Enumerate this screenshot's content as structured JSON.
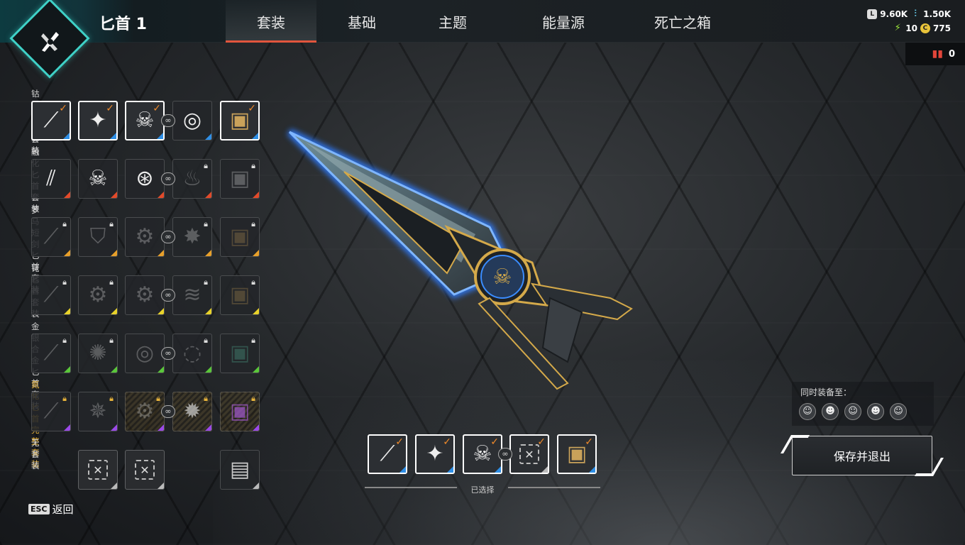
{
  "header": {
    "title": "匕首 1",
    "tabs": [
      {
        "label": "套装",
        "active": true
      },
      {
        "label": "基础",
        "active": false
      },
      {
        "label": "主题",
        "active": false
      },
      {
        "label": "能量源",
        "active": false
      },
      {
        "label": "死亡之箱",
        "active": false
      }
    ],
    "currency": {
      "legend_tokens": "9.60K",
      "crystals": "1.50K",
      "exotic": "10",
      "crafting": "775",
      "tickets": "0"
    }
  },
  "sets": [
    {
      "label": "钴蓝匕首套装",
      "gold": false
    },
    {
      "label": "融化匕首套装",
      "gold": false
    },
    {
      "label": "罗马短剑匕首套装",
      "gold": false
    },
    {
      "label": "铑匕首套装",
      "gold": false
    },
    {
      "label": "金银合金匕首套装",
      "gold": false
    },
    {
      "label": "氮化匕首完整套装",
      "gold": true
    },
    {
      "label": "无套装",
      "gold": false
    }
  ],
  "selected": {
    "label": "已选择"
  },
  "equip_panel": {
    "title": "同时装备至："
  },
  "actions": {
    "save_label": "保存并退出",
    "esc_key": "ESC",
    "back_label": "返回"
  },
  "colors": {
    "accent_teal": "#3fd1c7",
    "tab_underline": "#e2553d",
    "tick_orange": "#f08a2a",
    "rarity_blue": "#2f8fe6",
    "rarity_red": "#e24a2a",
    "rarity_orange": "#e8a02a",
    "rarity_yellow": "#e8d22a",
    "rarity_green": "#5ac83a",
    "rarity_purple": "#9b4ae8",
    "rarity_gray": "#bbbbbb"
  }
}
